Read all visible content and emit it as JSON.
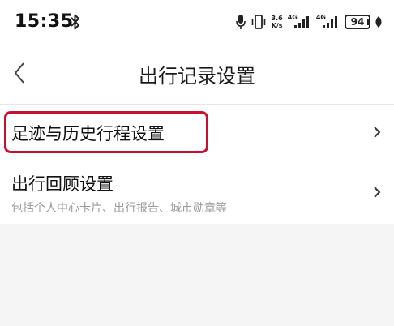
{
  "status_bar": {
    "time": "15:35",
    "net_speed_value": "3.6",
    "net_speed_unit": "K/s",
    "signal_1_label": "4G",
    "signal_2_label": "4G",
    "battery_level": "94",
    "icons": [
      "bluetooth-icon",
      "mic-icon",
      "vibrate-icon",
      "signal-icon",
      "battery-icon",
      "leaf-icon"
    ]
  },
  "header": {
    "title": "出行记录设置",
    "back_icon": "chevron-left-icon"
  },
  "settings": {
    "items": [
      {
        "title": "足迹与历史行程设置",
        "subtitle": "",
        "highlighted": true
      },
      {
        "title": "出行回顾设置",
        "subtitle": "包括个人中心卡片、出行报告、城市勋章等",
        "highlighted": false
      }
    ]
  },
  "colors": {
    "highlight": "#c8102e",
    "page_background": "#f5f5f5",
    "subtitle_text": "#9a9a9a"
  }
}
